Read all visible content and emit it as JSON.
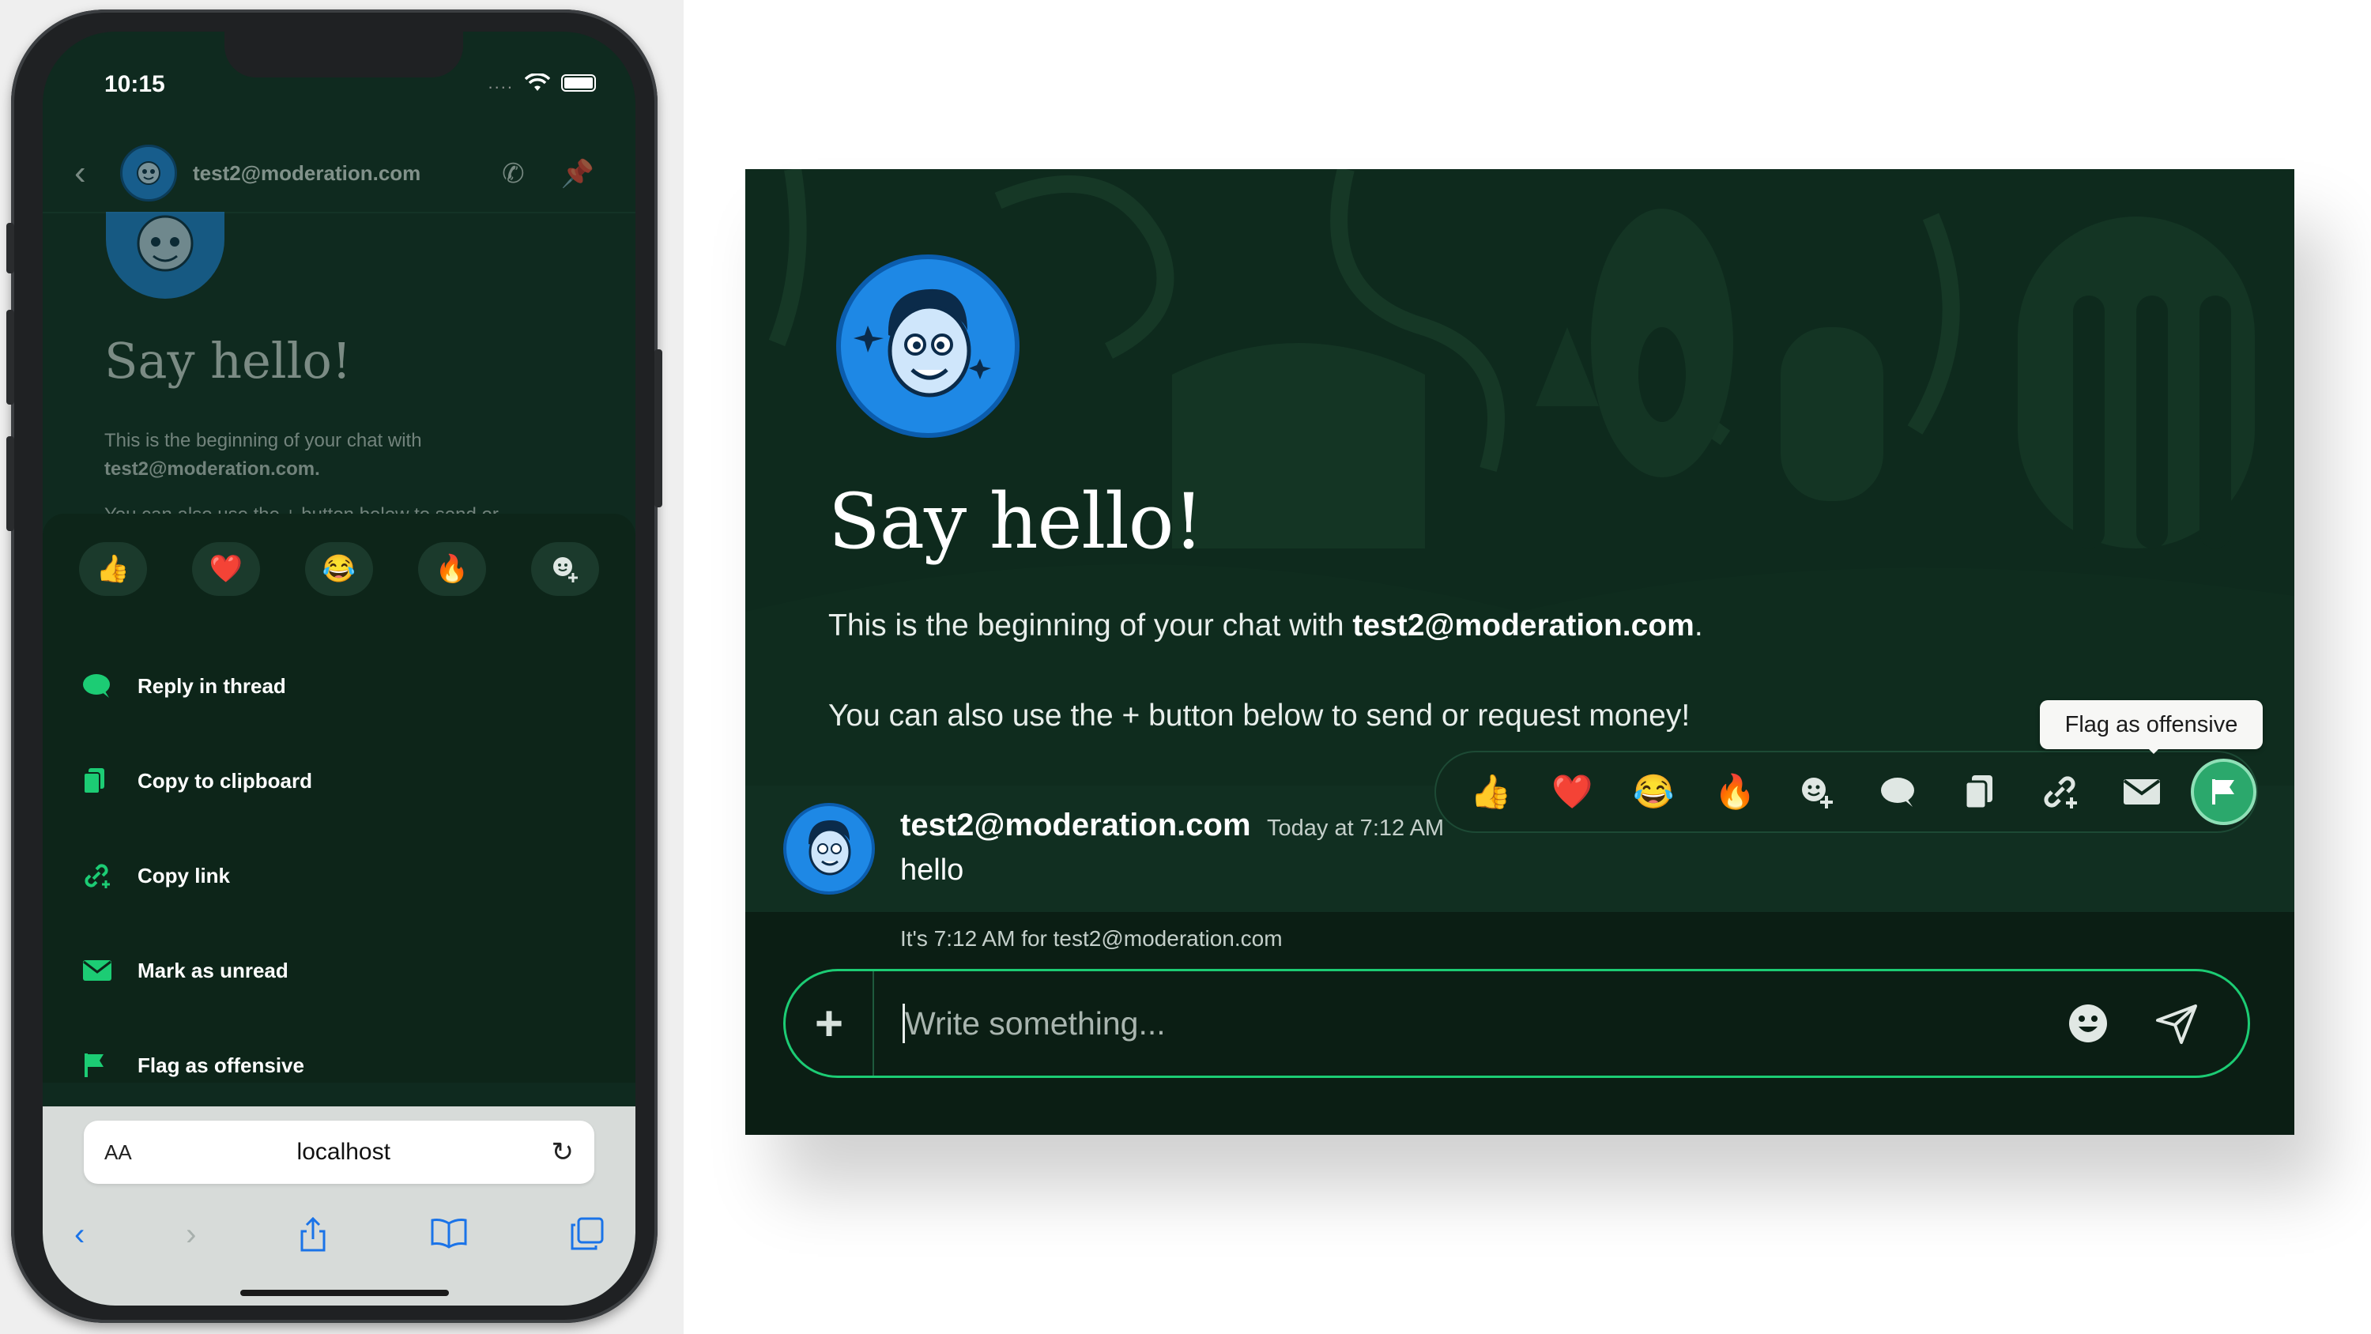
{
  "mobile": {
    "status": {
      "time": "10:15",
      "dots": "...."
    },
    "header": {
      "email": "test2@moderation.com"
    },
    "title": "Say hello!",
    "intro_prefix": "This is the beginning of your chat with",
    "intro_email": "test2@moderation.com.",
    "money_line": "You can also use the + button below to send or",
    "reactions": [
      "👍",
      "❤️",
      "😂",
      "🔥",
      "add-reaction-icon"
    ],
    "actions": [
      {
        "label": "Reply in thread",
        "icon": "chat-bubble-icon"
      },
      {
        "label": "Copy to clipboard",
        "icon": "clipboard-icon"
      },
      {
        "label": "Copy link",
        "icon": "link-icon"
      },
      {
        "label": "Mark as unread",
        "icon": "envelope-icon"
      },
      {
        "label": "Flag as offensive",
        "icon": "flag-icon"
      }
    ],
    "browser": {
      "aa": "AA",
      "host": "localhost"
    }
  },
  "desktop": {
    "title": "Say hello!",
    "intro_prefix": "This is the beginning of your chat with ",
    "intro_email": "test2@moderation.com",
    "intro_suffix": ".",
    "money_line": "You can also use the + button below to send or request money!",
    "message": {
      "author": "test2@moderation.com",
      "time": "Today at 7:12 AM",
      "text": "hello"
    },
    "local_time": "It's 7:12 AM for test2@moderation.com",
    "tooltip": "Flag as offensive",
    "reactions": [
      "👍",
      "❤️",
      "😂",
      "🔥"
    ],
    "composer": {
      "placeholder": "Write something..."
    }
  },
  "colors": {
    "accent": "#1ccc74",
    "panel_bg": "#0b1e14",
    "hero_bg": "#0e2a1d",
    "avatar_blue": "#1e88e5",
    "ios_blue": "#1a73e8"
  }
}
